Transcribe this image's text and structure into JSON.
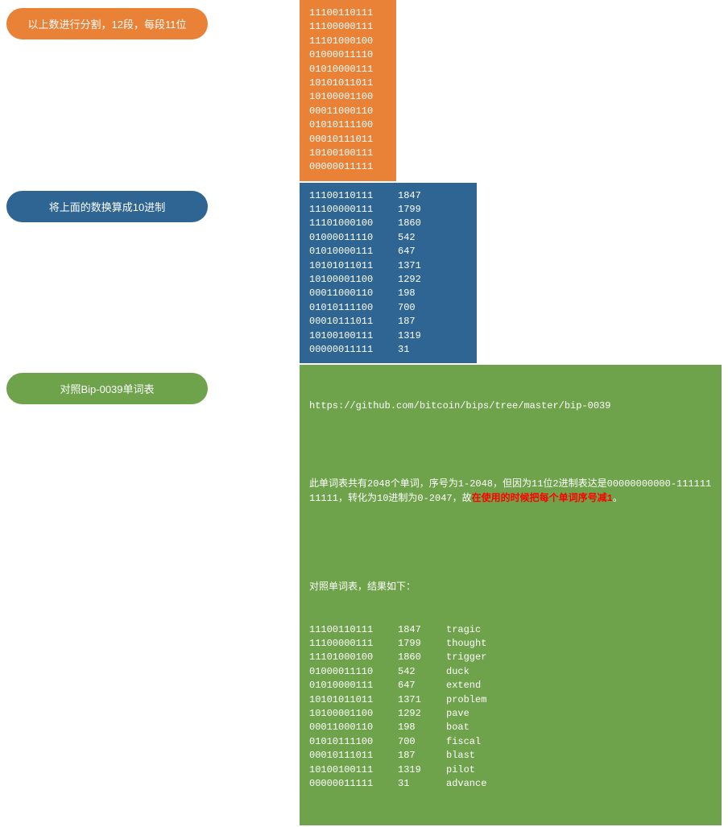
{
  "step1": {
    "label": "以上数进行分割，12段，每段11位",
    "lines": [
      "11100110111",
      "11100000111",
      "11101000100",
      "01000011110",
      "01010000111",
      "10101011011",
      "10100001100",
      "00011000110",
      "01010111100",
      "00010111011",
      "10100100111",
      "00000011111"
    ]
  },
  "step2": {
    "label": "将上面的数换算成10进制",
    "rows": [
      {
        "bin": "11100110111",
        "dec": "1847"
      },
      {
        "bin": "11100000111",
        "dec": "1799"
      },
      {
        "bin": "11101000100",
        "dec": "1860"
      },
      {
        "bin": "01000011110",
        "dec": "542"
      },
      {
        "bin": "01010000111",
        "dec": "647"
      },
      {
        "bin": "10101011011",
        "dec": "1371"
      },
      {
        "bin": "10100001100",
        "dec": "1292"
      },
      {
        "bin": "00011000110",
        "dec": "198"
      },
      {
        "bin": "01010111100",
        "dec": "700"
      },
      {
        "bin": "00010111011",
        "dec": "187"
      },
      {
        "bin": "10100100111",
        "dec": "1319"
      },
      {
        "bin": "00000011111",
        "dec": "31"
      }
    ]
  },
  "step3": {
    "label": "对照Bip-0039单词表",
    "url": "https://github.com/bitcoin/bips/tree/master/bip-0039",
    "note_a": "此单词表共有2048个单词，序号为1-2048，但因为11位2进制表达是00000000000-11111111111，转化为10进制为0-2047，故",
    "note_warn": "在使用的时候把每个单词序号减1",
    "note_b": "。",
    "result_header": "对照单词表，结果如下：",
    "rows": [
      {
        "bin": "11100110111",
        "dec": "1847",
        "word": "tragic"
      },
      {
        "bin": "11100000111",
        "dec": "1799",
        "word": "thought"
      },
      {
        "bin": "11101000100",
        "dec": "1860",
        "word": "trigger"
      },
      {
        "bin": "01000011110",
        "dec": "542",
        "word": "duck"
      },
      {
        "bin": "01010000111",
        "dec": "647",
        "word": "extend"
      },
      {
        "bin": "10101011011",
        "dec": "1371",
        "word": "problem"
      },
      {
        "bin": "10100001100",
        "dec": "1292",
        "word": "pave"
      },
      {
        "bin": "00011000110",
        "dec": "198",
        "word": "boat"
      },
      {
        "bin": "01010111100",
        "dec": "700",
        "word": "fiscal"
      },
      {
        "bin": "00010111011",
        "dec": "187",
        "word": "blast"
      },
      {
        "bin": "10100100111",
        "dec": "1319",
        "word": "pilot"
      },
      {
        "bin": "00000011111",
        "dec": "31",
        "word": "advance"
      }
    ]
  }
}
